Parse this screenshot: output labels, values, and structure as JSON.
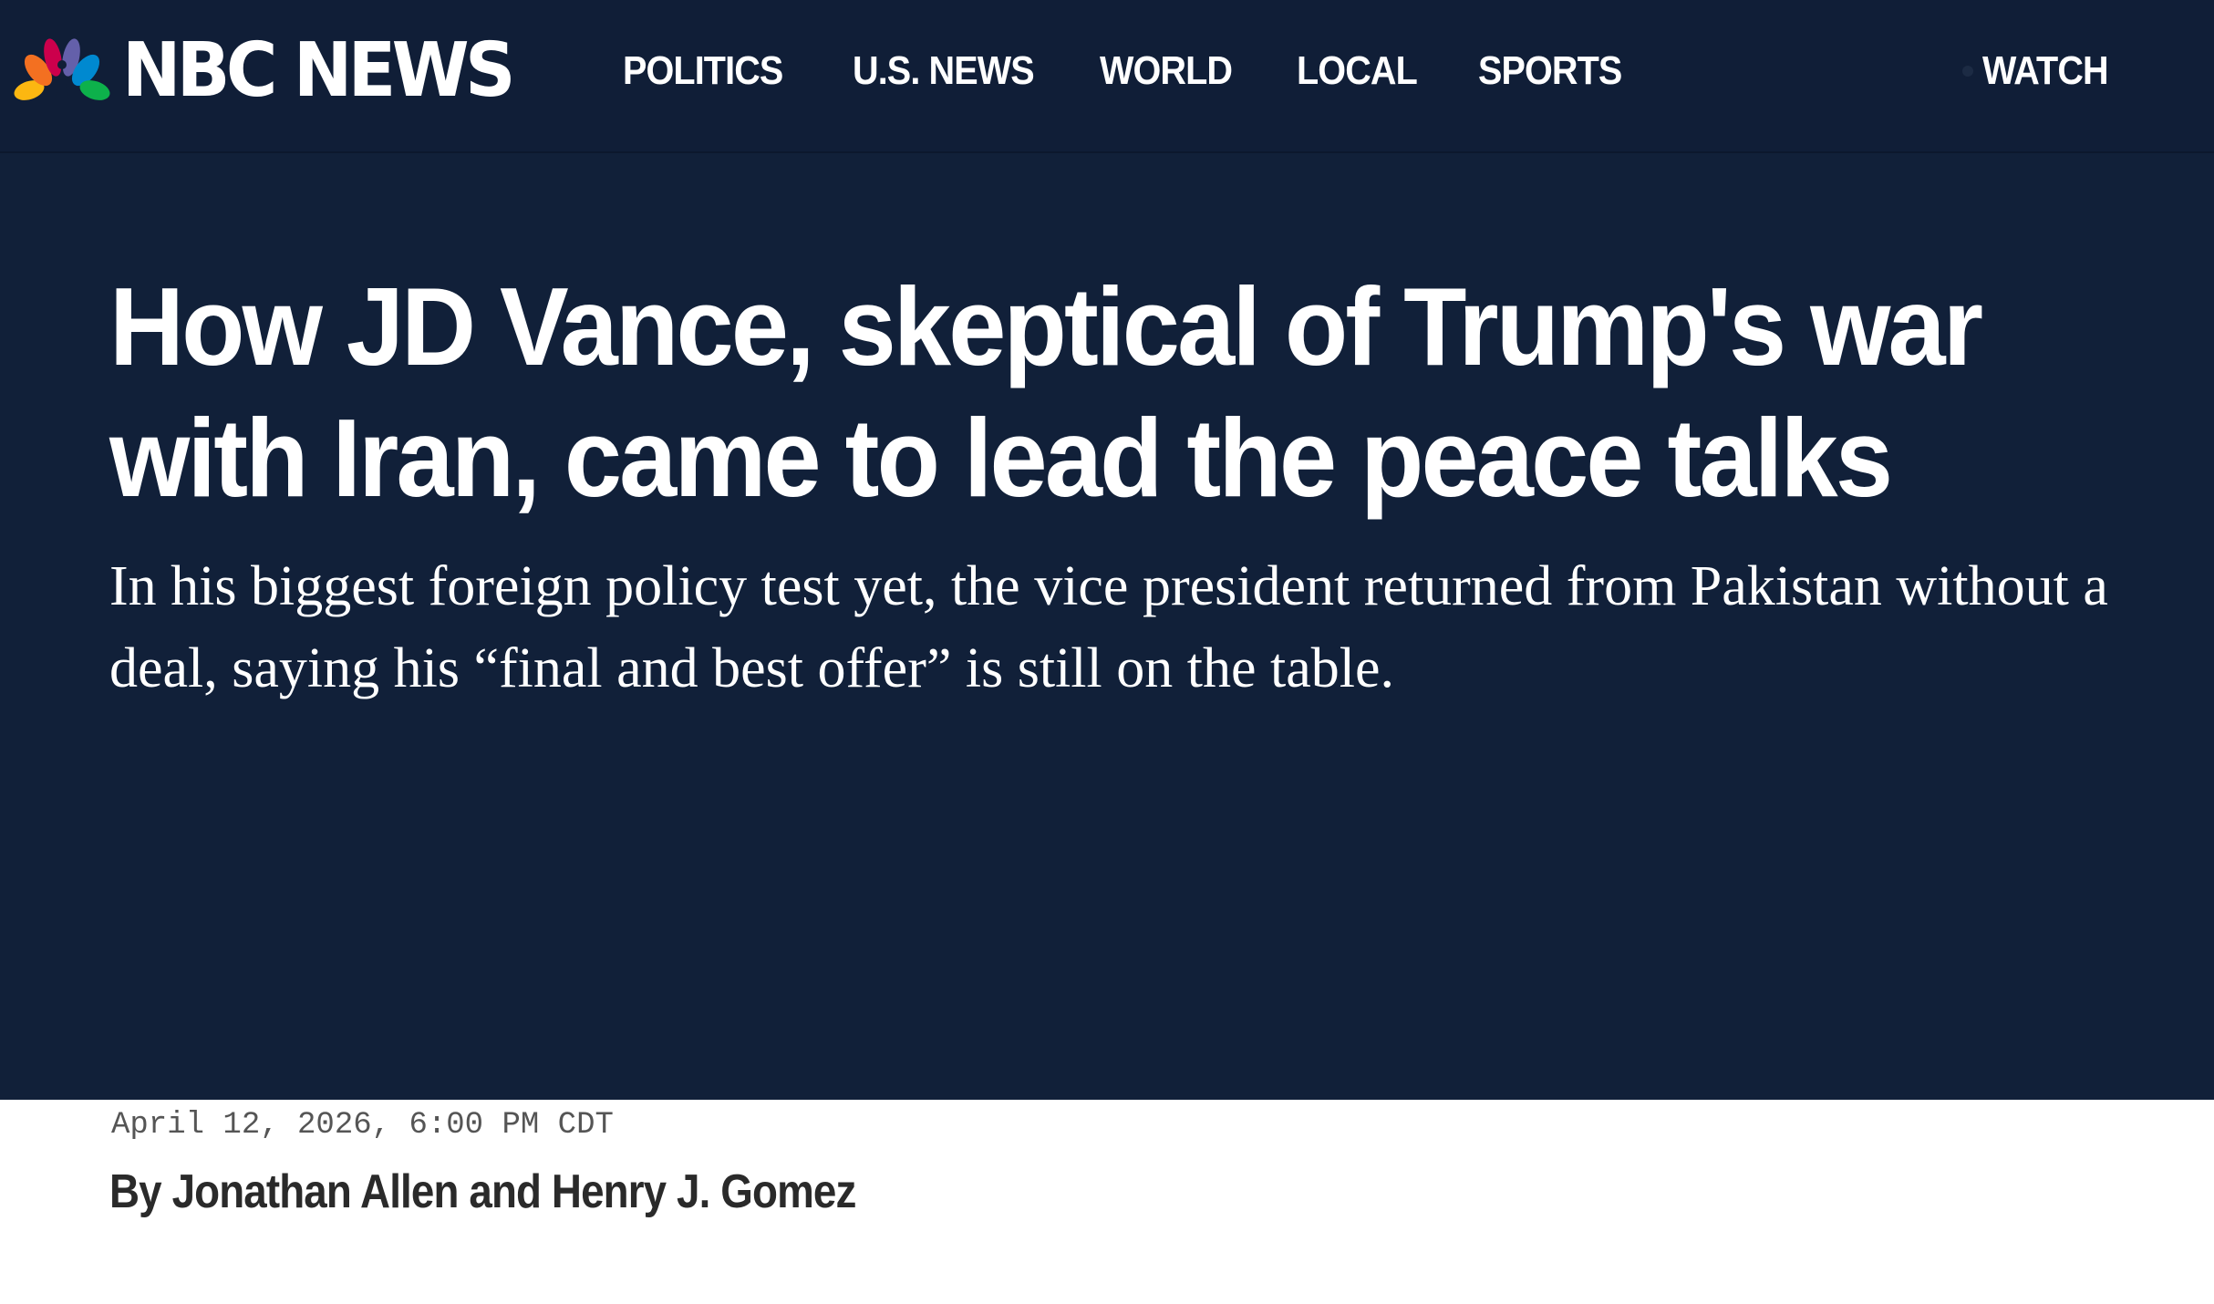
{
  "header": {
    "brand": "NBC NEWS",
    "nav": [
      {
        "label": "POLITICS"
      },
      {
        "label": "U.S. NEWS"
      },
      {
        "label": "WORLD"
      },
      {
        "label": "LOCAL"
      },
      {
        "label": "SPORTS"
      }
    ],
    "watch_label": "WATCH",
    "icons": {
      "logo": "nbc-peacock-icon",
      "live": "live-dot-icon"
    }
  },
  "article": {
    "headline": "How JD Vance, skeptical of Trump's war with Iran, came to lead the peace talks",
    "dek": "In his biggest foreign policy test yet, the vice president returned from Pakistan without a deal, saying his “final and best offer” is still on the table.",
    "timestamp": "April 12, 2026, 6:00 PM CDT",
    "byline": "By Jonathan Allen and Henry J. Gomez"
  },
  "colors": {
    "nav_background": "#101e37",
    "hero_background": "#112039",
    "text_on_dark": "#ffffff",
    "byline_text": "#2a2a2a",
    "timestamp_text": "#555555",
    "peacock_yellow": "#fcb711",
    "peacock_orange": "#f37021",
    "peacock_red": "#cc004c",
    "peacock_purple": "#6460aa",
    "peacock_blue": "#0089d0",
    "peacock_green": "#0db14b"
  }
}
